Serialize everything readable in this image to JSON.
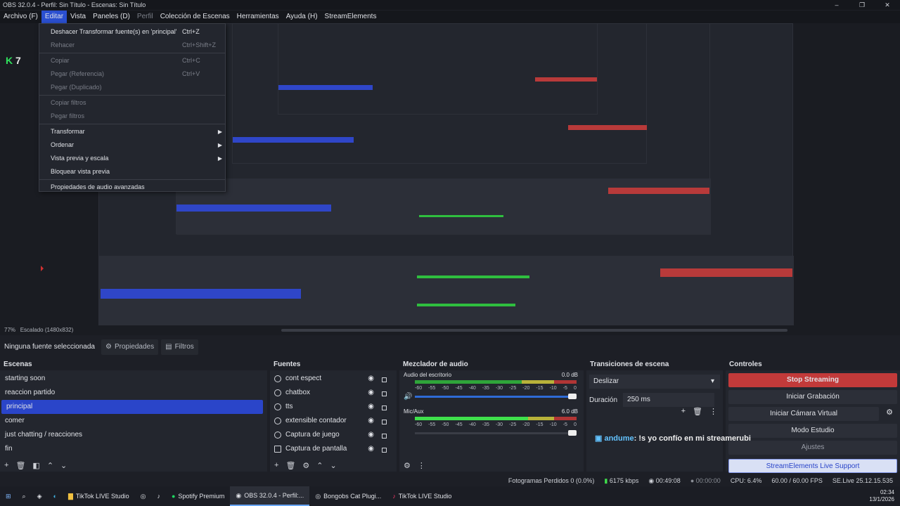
{
  "window": {
    "title": "OBS 32.0.4 - Perfil: Sin Título - Escenas: Sin Título"
  },
  "menubar": [
    "Archivo (F)",
    "Editar",
    "Vista",
    "Paneles (D)",
    "Perfil",
    "Colección de Escenas",
    "Herramientas",
    "Ayuda (H)",
    "StreamElements"
  ],
  "edit_menu": [
    {
      "label": "Deshacer Transformar fuente(s) en 'principal'",
      "shortcut": "Ctrl+Z",
      "disabled": false
    },
    {
      "label": "Rehacer",
      "shortcut": "Ctrl+Shift+Z",
      "disabled": true
    },
    {
      "label": "Copiar",
      "shortcut": "Ctrl+C",
      "disabled": true
    },
    {
      "label": "Pegar (Referencia)",
      "shortcut": "Ctrl+V",
      "disabled": true
    },
    {
      "label": "Pegar (Duplicado)",
      "shortcut": "",
      "disabled": true
    },
    {
      "label": "Copiar filtros",
      "shortcut": "",
      "disabled": true
    },
    {
      "label": "Pegar filtros",
      "shortcut": "",
      "disabled": true
    },
    {
      "label": "Transformar",
      "submenu": true
    },
    {
      "label": "Ordenar",
      "submenu": true
    },
    {
      "label": "Vista previa y escala",
      "submenu": true
    },
    {
      "label": "Bloquear vista previa"
    },
    {
      "label": "Propiedades de audio avanzadas"
    }
  ],
  "preview": {
    "badge": "7",
    "zoom": "77%",
    "scale_label": "Escalado (1480x832)"
  },
  "source_bar": {
    "none_label": "Ninguna fuente seleccionada",
    "properties": "Propiedades",
    "filters": "Filtros"
  },
  "scenes": {
    "title": "Escenas",
    "items": [
      "starting soon",
      "reaccion partido",
      "principal",
      "comer",
      "just chatting / reacciones",
      "fin"
    ],
    "selected": 2
  },
  "sources": {
    "title": "Fuentes",
    "items": [
      "cont espect",
      "chatbox",
      "tts",
      "extensible contador",
      "Captura de juego",
      "Captura de pantalla"
    ]
  },
  "mixer": {
    "title": "Mezclador de audio",
    "channels": [
      {
        "name": "Audio del escritorio",
        "db": "0.0 dB",
        "level": 0
      },
      {
        "name": "Mic/Aux",
        "db": "6.0 dB",
        "level": 0.7
      }
    ],
    "scale": [
      "-60",
      "-55",
      "-50",
      "-45",
      "-40",
      "-35",
      "-30",
      "-25",
      "-20",
      "-15",
      "-10",
      "-5",
      "0"
    ]
  },
  "transitions": {
    "title": "Transiciones de escena",
    "type": "Deslizar",
    "duration_label": "Duración",
    "duration": "250 ms"
  },
  "controls": {
    "title": "Controles",
    "buttons": [
      "Stop Streaming",
      "Iniciar Grabación",
      "Iniciar Cámara Virtual",
      "Modo Estudio",
      "Ajustes"
    ],
    "se_button": "StreamElements Live Support"
  },
  "chat": {
    "user": "andume",
    "message": ": !s yo confío en mi streamerubi"
  },
  "status": {
    "dropped": "Fotogramas Perdidos 0 (0.0%)",
    "bitrate": "6175 kbps",
    "stream_time": "00:49:08",
    "rec_time": "00:00:00",
    "cpu": "CPU: 6.4%",
    "fps": "60.00 / 60.00 FPS",
    "version": "SE.Live 25.12.15.535"
  },
  "taskbar": {
    "apps": [
      "TikTok LIVE Studio",
      "Spotify Premium",
      "OBS 32.0.4 - Perfil:...",
      "Bongobs Cat Plugi...",
      "TikTok LIVE Studio"
    ],
    "time": "02:34",
    "date": "13/1/2026"
  }
}
